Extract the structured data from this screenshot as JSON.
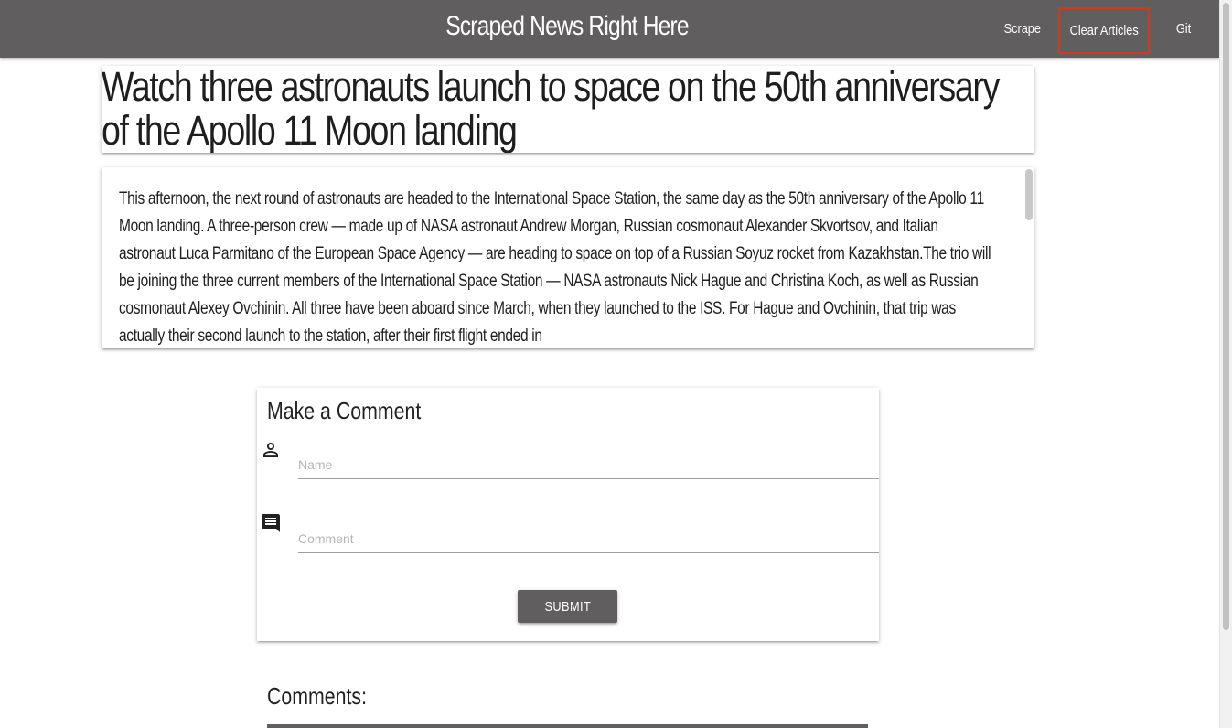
{
  "navbar": {
    "brand": "Scraped News Right Here",
    "links": {
      "scrape": "Scrape",
      "clear_articles": "Clear Articles",
      "git_repo": "Git Repo"
    },
    "color": "#615e60",
    "highlight_color": "#d0391e"
  },
  "article": {
    "title": "Watch three astronauts launch to space on the 50th anniversary of the Apollo 11 Moon landing",
    "body": "This afternoon, the next round of astronauts are headed to the International Space Station, the same day as the 50th anniversary of the Apollo 11 Moon landing. A three-person crew — made up of NASA astronaut Andrew Morgan, Russian cosmonaut Alexander Skvortsov, and Italian astronaut Luca Parmitano of the European Space Agency — are heading to space on top of a Russian Soyuz rocket from Kazakhstan.The trio will be joining the three current members of the International Space Station — NASA astronauts Nick Hague and Christina Koch, as well as Russian cosmonaut Alexey Ovchinin. All three have been aboard since March, when they launched to the ISS. For Hague and Ovchinin, that trip was actually their second launch to the station, after their first flight ended in"
  },
  "comment_form": {
    "title": "Make a Comment",
    "name_placeholder": "Name",
    "comment_placeholder": "Comment",
    "submit_label": "Submit",
    "icons": {
      "name": "person-icon",
      "comment": "chat-icon"
    }
  },
  "comments": {
    "heading": "Comments:"
  }
}
